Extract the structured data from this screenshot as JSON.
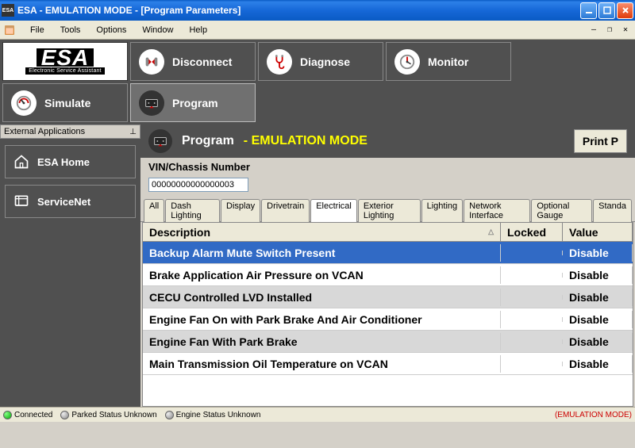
{
  "titlebar": {
    "text": "ESA  - EMULATION MODE  - [Program Parameters]"
  },
  "menu": {
    "items": [
      "File",
      "Tools",
      "Options",
      "Window",
      "Help"
    ]
  },
  "logo": {
    "top": "ESA",
    "bottom": "Electronic Service Assistant"
  },
  "toolbar": {
    "disconnect": "Disconnect",
    "diagnose": "Diagnose",
    "monitor": "Monitor",
    "simulate": "Simulate",
    "program": "Program"
  },
  "sidebar": {
    "header": "External Applications",
    "home": "ESA Home",
    "servicenet": "ServiceNet"
  },
  "content": {
    "title": "Program",
    "mode": "- EMULATION MODE",
    "print": "Print P",
    "vin_label": "VIN/Chassis Number",
    "vin_value": "00000000000000003"
  },
  "tabs": [
    "All",
    "Dash Lighting",
    "Display",
    "Drivetrain",
    "Electrical",
    "Exterior Lighting",
    "Lighting",
    "Network Interface",
    "Optional Gauge",
    "Standa"
  ],
  "active_tab": 4,
  "columns": {
    "desc": "Description",
    "locked": "Locked",
    "value": "Value"
  },
  "rows": [
    {
      "desc": "Backup Alarm Mute Switch Present",
      "locked": "",
      "value": "Disable",
      "selected": true
    },
    {
      "desc": "Brake Application Air Pressure on VCAN",
      "locked": "",
      "value": "Disable"
    },
    {
      "desc": "CECU Controlled LVD Installed",
      "locked": "",
      "value": "Disable",
      "alt": true
    },
    {
      "desc": "Engine Fan On with Park Brake And Air Conditioner",
      "locked": "",
      "value": "Disable"
    },
    {
      "desc": "Engine Fan With Park Brake",
      "locked": "",
      "value": "Disable",
      "alt": true
    },
    {
      "desc": "Main Transmission Oil Temperature on VCAN",
      "locked": "",
      "value": "Disable"
    }
  ],
  "status": {
    "connected": "Connected",
    "parked": "Parked Status Unknown",
    "engine": "Engine Status Unknown",
    "mode": "(EMULATION MODE)"
  }
}
